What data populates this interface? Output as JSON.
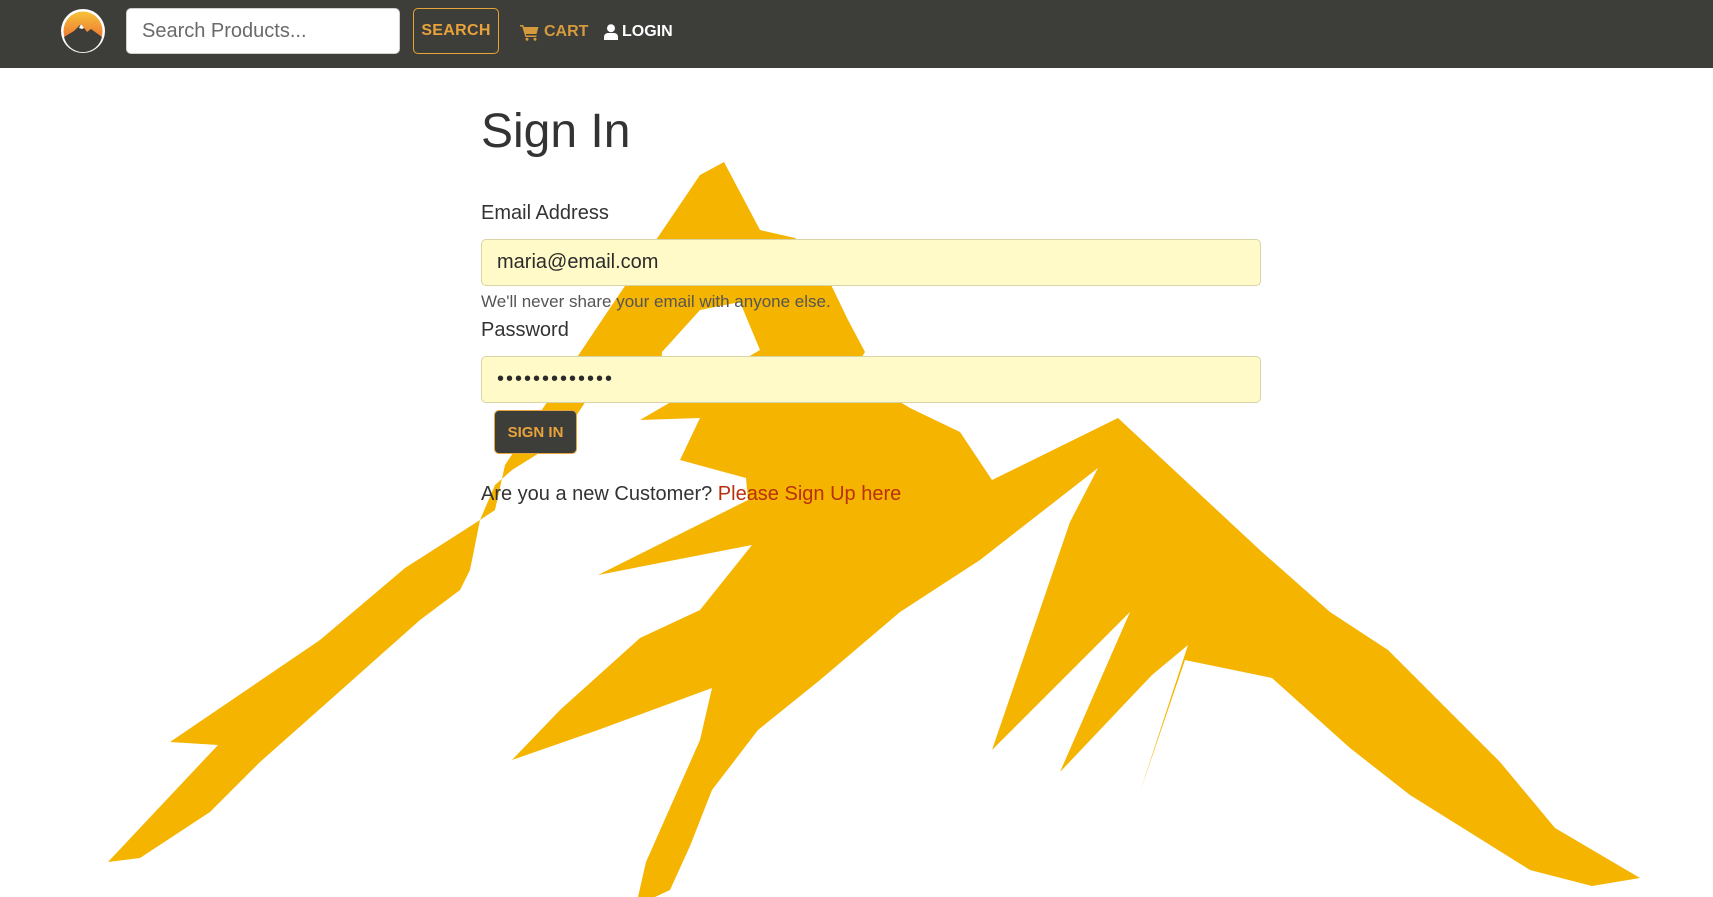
{
  "colors": {
    "navbar_bg": "#3d3d3a",
    "accent": "#e8a33a",
    "mountain": "#f4b400",
    "field_bg": "#fffac8",
    "link": "#b8300d"
  },
  "navbar": {
    "logo_icon": "mountain-sun-logo-icon",
    "search": {
      "placeholder": "Search Products...",
      "value": ""
    },
    "search_button_label": "SEARCH",
    "cart": {
      "icon": "shopping-cart-icon",
      "label": "CART"
    },
    "login": {
      "icon": "user-icon",
      "label": "LOGIN"
    }
  },
  "background": {
    "icon": "mountain-background-icon"
  },
  "form": {
    "title": "Sign In",
    "email_label": "Email Address",
    "email_value": "maria@email.com",
    "email_help": "We'll never share your email with anyone else.",
    "password_label": "Password",
    "password_value": "•••••••••••••",
    "submit_label": "SIGN IN",
    "signup_prompt": "Are you a new Customer? ",
    "signup_link": "Please Sign Up here"
  }
}
